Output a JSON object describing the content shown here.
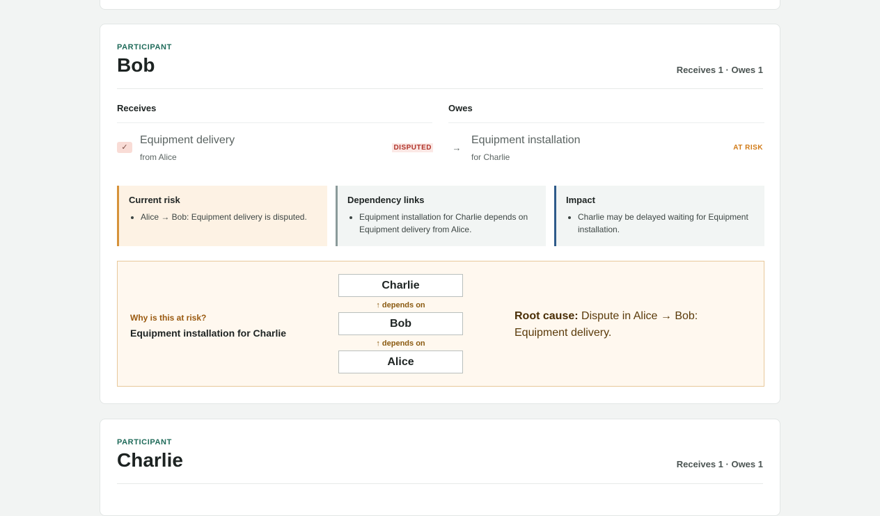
{
  "participants": [
    {
      "eyebrow": "PARTICIPANT",
      "name": "Bob",
      "summary": "Receives 1 · Owes 1",
      "receives_heading": "Receives",
      "owes_heading": "Owes",
      "receives": {
        "icon": "check-icon",
        "title": "Equipment delivery",
        "sub": "from Alice",
        "status": "DISPUTED"
      },
      "owes": {
        "icon": "arrow-right-icon",
        "title": "Equipment installation",
        "sub": "for Charlie",
        "status": "AT RISK"
      },
      "panels": {
        "risk": {
          "title": "Current risk",
          "items": [
            "Alice → Bob: Equipment delivery is disputed."
          ]
        },
        "deps": {
          "title": "Dependency links",
          "items": [
            "Equipment installation for Charlie depends on Equipment delivery from Alice."
          ]
        },
        "impact": {
          "title": "Impact",
          "items": [
            "Charlie may be delayed waiting for Equipment installation."
          ]
        }
      },
      "why": {
        "label": "Why is this at risk?",
        "target": "Equipment installation for Charlie",
        "chain": [
          "Charlie",
          "Bob",
          "Alice"
        ],
        "link_label": "↑ depends on",
        "root_cause_label": "Root cause:",
        "root_cause_text": "Dispute in Alice → Bob: Equipment delivery."
      }
    },
    {
      "eyebrow": "PARTICIPANT",
      "name": "Charlie",
      "summary": "Receives 1 · Owes 1"
    }
  ],
  "colors": {
    "accent": "#1f6b5a",
    "disputed": "#b0332a",
    "at_risk": "#d17a16",
    "risk_border": "#d6923a",
    "impact_border": "#2e5b8a"
  }
}
